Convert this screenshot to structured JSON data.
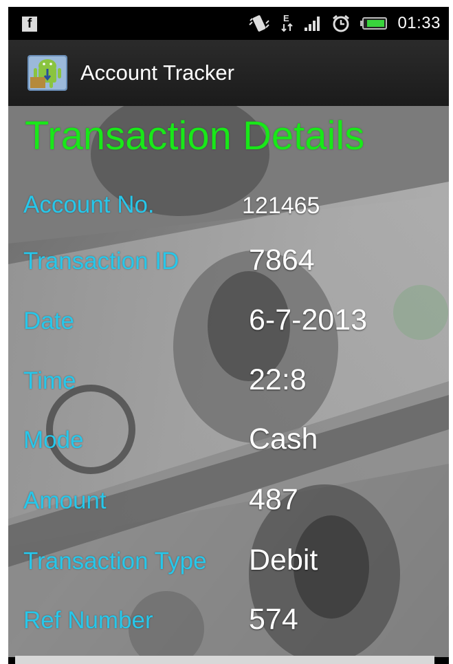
{
  "status_bar": {
    "notification_icon": "facebook-icon",
    "icons": [
      "vibrate-icon",
      "edge-data-icon",
      "signal-icon",
      "alarm-icon",
      "battery-icon"
    ],
    "data_network": "E",
    "time": "01:33"
  },
  "action_bar": {
    "app_icon": "android-app-icon",
    "title": "Account Tracker"
  },
  "screen": {
    "title": "Transaction Details",
    "fields": [
      {
        "label": "Account No.",
        "value": "121465"
      },
      {
        "label": "Transaction ID",
        "value": "7864"
      },
      {
        "label": "Date",
        "value": "6-7-2013"
      },
      {
        "label": "Time",
        "value": "22:8"
      },
      {
        "label": "Mode",
        "value": "Cash"
      },
      {
        "label": "Amount",
        "value": "487"
      },
      {
        "label": "Transaction Type",
        "value": "Debit"
      },
      {
        "label": "Ref Number",
        "value": "574"
      }
    ]
  },
  "colors": {
    "title_green": "#19e819",
    "label_blue": "#27c7ea",
    "value_white": "#ffffff",
    "action_bar": "#222222"
  }
}
